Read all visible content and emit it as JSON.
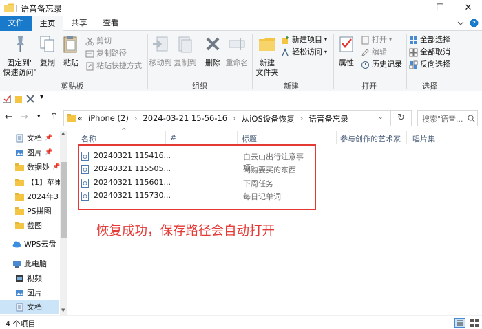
{
  "window": {
    "title": "语音备忘录",
    "controls": {
      "minimize": "—",
      "maximize": "☐",
      "close": "✕"
    }
  },
  "ribbon_tabs": [
    "文件",
    "主页",
    "共享",
    "查看"
  ],
  "ribbon": {
    "clipboard": {
      "pin_label": "固定到\"\n快速访问\"",
      "copy_label": "复制",
      "paste_label": "粘贴",
      "cut_label": "剪切",
      "copy_path_label": "复制路径",
      "paste_shortcut_label": "粘贴快捷方式",
      "group_label": "剪贴板"
    },
    "organize": {
      "move_to_label": "移动到",
      "copy_to_label": "复制到",
      "delete_label": "删除",
      "rename_label": "重命名",
      "group_label": "组织"
    },
    "new": {
      "new_folder_label": "新建\n文件夹",
      "new_item_label": "新建项目",
      "easy_access_label": "轻松访问",
      "group_label": "新建"
    },
    "open": {
      "properties_label": "属性",
      "open_label": "打开",
      "edit_label": "编辑",
      "history_label": "历史记录",
      "group_label": "打开"
    },
    "select": {
      "select_all_label": "全部选择",
      "select_none_label": "全部取消",
      "invert_label": "反向选择",
      "group_label": "选择"
    }
  },
  "address": {
    "overflow": "«",
    "crumbs": [
      "iPhone (2)",
      "2024-03-21 15-56-16",
      "从iOS设备恢复",
      "语音备忘录"
    ],
    "search_placeholder": "搜索\"语音..."
  },
  "nav_pane": {
    "items": [
      {
        "label": "文档",
        "pinned": true
      },
      {
        "label": "图片",
        "pinned": true
      },
      {
        "label": "数据处",
        "pinned": true
      },
      {
        "label": "【1】苹果",
        "pinned": false
      },
      {
        "label": "2024年3",
        "pinned": false
      },
      {
        "label": "PS拼图",
        "pinned": false
      },
      {
        "label": "截图",
        "pinned": false
      },
      {
        "label": "WPS云盘",
        "pinned": false
      },
      {
        "label": "此电脑",
        "pinned": false
      },
      {
        "label": "视频",
        "pinned": false
      },
      {
        "label": "图片",
        "pinned": false
      },
      {
        "label": "文档",
        "pinned": false
      }
    ]
  },
  "columns": [
    "名称",
    "#",
    "标题",
    "参与创作的艺术家",
    "唱片集"
  ],
  "files": [
    {
      "name": "20240321 115416...",
      "title": "白云山出行注意事项"
    },
    {
      "name": "20240321 115505...",
      "title": "网购要买的东西"
    },
    {
      "name": "20240321 115601...",
      "title": "下周任务"
    },
    {
      "name": "20240321 115730...",
      "title": "每日记单词"
    }
  ],
  "annotation": "恢复成功，保存路径会自动打开",
  "status": {
    "count": "4 个项目"
  },
  "colors": {
    "accent": "#1979ca",
    "annotation": "#e53935",
    "folder": "#f4c542"
  }
}
